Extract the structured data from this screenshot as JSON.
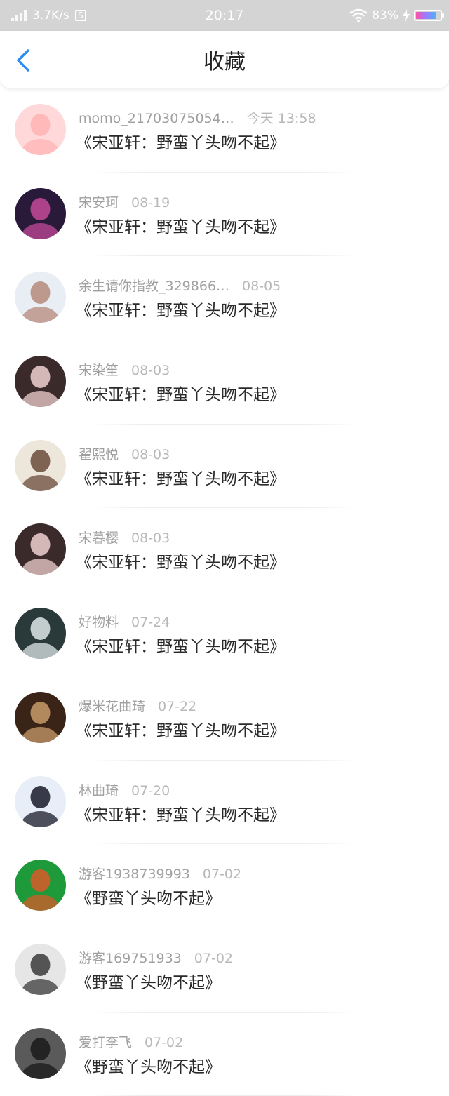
{
  "status_bar": {
    "speed": "3.7K/s",
    "s_icon": "S",
    "time": "20:17",
    "battery_percent": "83%",
    "battery_level": 0.83
  },
  "header": {
    "title": "收藏",
    "back_icon": "chevron-left-icon"
  },
  "items": [
    {
      "name": "momo_21703075054…",
      "date": "今天 13:58",
      "title": "《宋亚轩：野蛮丫头吻不起》",
      "avatar_colors": [
        "#ffd9d9",
        "#ffb3b3"
      ]
    },
    {
      "name": "宋安珂",
      "date": "08-19",
      "title": "《宋亚轩：野蛮丫头吻不起》",
      "avatar_colors": [
        "#2a1a3a",
        "#c44a9a"
      ]
    },
    {
      "name": "余生请你指教_329866…",
      "date": "08-05",
      "title": "《宋亚轩：野蛮丫头吻不起》",
      "avatar_colors": [
        "#e9eef5",
        "#b58a7a"
      ]
    },
    {
      "name": "宋染笙",
      "date": "08-03",
      "title": "《宋亚轩：野蛮丫头吻不起》",
      "avatar_colors": [
        "#3a2a2a",
        "#f0d0d0"
      ]
    },
    {
      "name": "翟熙悦",
      "date": "08-03",
      "title": "《宋亚轩：野蛮丫头吻不起》",
      "avatar_colors": [
        "#ede6da",
        "#6a4a3a"
      ]
    },
    {
      "name": "宋暮樱",
      "date": "08-03",
      "title": "《宋亚轩：野蛮丫头吻不起》",
      "avatar_colors": [
        "#3a2a2a",
        "#f0d0d0"
      ]
    },
    {
      "name": "好物料",
      "date": "07-24",
      "title": "《宋亚轩：野蛮丫头吻不起》",
      "avatar_colors": [
        "#2a3a3a",
        "#dfe7e7"
      ]
    },
    {
      "name": "爆米花曲琦",
      "date": "07-22",
      "title": "《宋亚轩：野蛮丫头吻不起》",
      "avatar_colors": [
        "#3a2418",
        "#c89a6a"
      ]
    },
    {
      "name": "林曲琦",
      "date": "07-20",
      "title": "《宋亚轩：野蛮丫头吻不起》",
      "avatar_colors": [
        "#e8eef8",
        "#1a1a2a"
      ]
    },
    {
      "name": "游客1938739993",
      "date": "07-02",
      "title": "《野蛮丫头吻不起》",
      "avatar_colors": [
        "#1f9a3a",
        "#d85a2a"
      ]
    },
    {
      "name": "游客169751933",
      "date": "07-02",
      "title": "《野蛮丫头吻不起》",
      "avatar_colors": [
        "#e6e6e6",
        "#3a3a3a"
      ]
    },
    {
      "name": "爱打李飞",
      "date": "07-02",
      "title": "《野蛮丫头吻不起》",
      "avatar_colors": [
        "#5a5a5a",
        "#1a1a1a"
      ]
    }
  ]
}
